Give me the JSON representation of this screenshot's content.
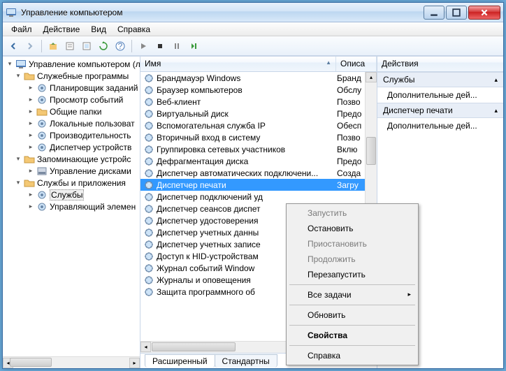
{
  "window": {
    "title": "Управление компьютером"
  },
  "menu": [
    "Файл",
    "Действие",
    "Вид",
    "Справка"
  ],
  "tree": {
    "root": "Управление компьютером (л",
    "groups": [
      {
        "label": "Служебные программы",
        "expanded": true,
        "children": [
          "Планировщик заданий",
          "Просмотр событий",
          "Общие папки",
          "Локальные пользоват",
          "Производительность",
          "Диспетчер устройств"
        ]
      },
      {
        "label": "Запоминающие устройс",
        "expanded": true,
        "children": [
          "Управление дисками"
        ]
      },
      {
        "label": "Службы и приложения",
        "expanded": true,
        "children": [
          "Службы",
          "Управляющий элемен"
        ]
      }
    ],
    "selected": "Службы"
  },
  "list": {
    "columns": {
      "name": "Имя",
      "desc": "Описа"
    },
    "rows": [
      {
        "name": "Брандмауэр Windows",
        "desc": "Бранд"
      },
      {
        "name": "Браузер компьютеров",
        "desc": "Обслу"
      },
      {
        "name": "Веб-клиент",
        "desc": "Позво"
      },
      {
        "name": "Виртуальный диск",
        "desc": "Предо"
      },
      {
        "name": "Вспомогательная служба IP",
        "desc": "Обесп"
      },
      {
        "name": "Вторичный вход в систему",
        "desc": "Позво"
      },
      {
        "name": "Группировка сетевых участников",
        "desc": "Вклю"
      },
      {
        "name": "Дефрагментация диска",
        "desc": "Предо"
      },
      {
        "name": "Диспетчер автоматических подключени...",
        "desc": "Созда"
      },
      {
        "name": "Диспетчер печати",
        "desc": "Загру",
        "selected": true
      },
      {
        "name": "Диспетчер подключений уд",
        "desc": ""
      },
      {
        "name": "Диспетчер сеансов диспет",
        "desc": ""
      },
      {
        "name": "Диспетчер удостоверения",
        "desc": ""
      },
      {
        "name": "Диспетчер учетных данны",
        "desc": ""
      },
      {
        "name": "Диспетчер учетных записе",
        "desc": ""
      },
      {
        "name": "Доступ к HID-устройствам",
        "desc": ""
      },
      {
        "name": "Журнал событий Window",
        "desc": ""
      },
      {
        "name": "Журналы и оповещения",
        "desc": ""
      },
      {
        "name": "Защита программного об",
        "desc": ""
      }
    ]
  },
  "tabs": {
    "extended": "Расширенный",
    "standard": "Стандартны"
  },
  "actions": {
    "header": "Действия",
    "sections": [
      {
        "title": "Службы",
        "links": [
          "Дополнительные дей..."
        ]
      },
      {
        "title": "Диспетчер печати",
        "links": [
          "Дополнительные дей..."
        ]
      }
    ]
  },
  "context": [
    {
      "label": "Запустить",
      "disabled": true
    },
    {
      "label": "Остановить"
    },
    {
      "label": "Приостановить",
      "disabled": true
    },
    {
      "label": "Продолжить",
      "disabled": true
    },
    {
      "label": "Перезапустить"
    },
    {
      "sep": true
    },
    {
      "label": "Все задачи",
      "submenu": true
    },
    {
      "sep": true
    },
    {
      "label": "Обновить"
    },
    {
      "sep": true
    },
    {
      "label": "Свойства",
      "bold": true
    },
    {
      "sep": true
    },
    {
      "label": "Справка"
    }
  ]
}
